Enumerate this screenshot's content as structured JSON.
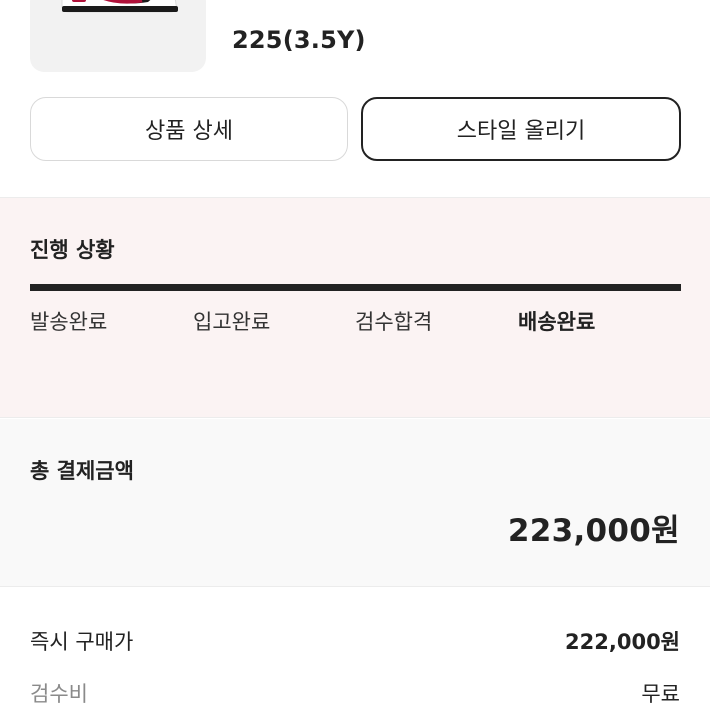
{
  "product": {
    "size": "225(3.5Y)"
  },
  "actions": {
    "detail_label": "상품 상세",
    "style_label": "스타일 올리기"
  },
  "progress": {
    "title": "진행 상황",
    "steps": [
      {
        "label": "발송완료",
        "active": false
      },
      {
        "label": "입고완료",
        "active": false
      },
      {
        "label": "검수합격",
        "active": false
      },
      {
        "label": "배송완료",
        "active": true
      }
    ],
    "completed_fraction": 1.0
  },
  "payment": {
    "title": "총 결제금액",
    "total": "223,000원",
    "rows": [
      {
        "label": "즉시 구매가",
        "value": "222,000원"
      },
      {
        "label": "검수비",
        "value": "무료"
      }
    ]
  }
}
